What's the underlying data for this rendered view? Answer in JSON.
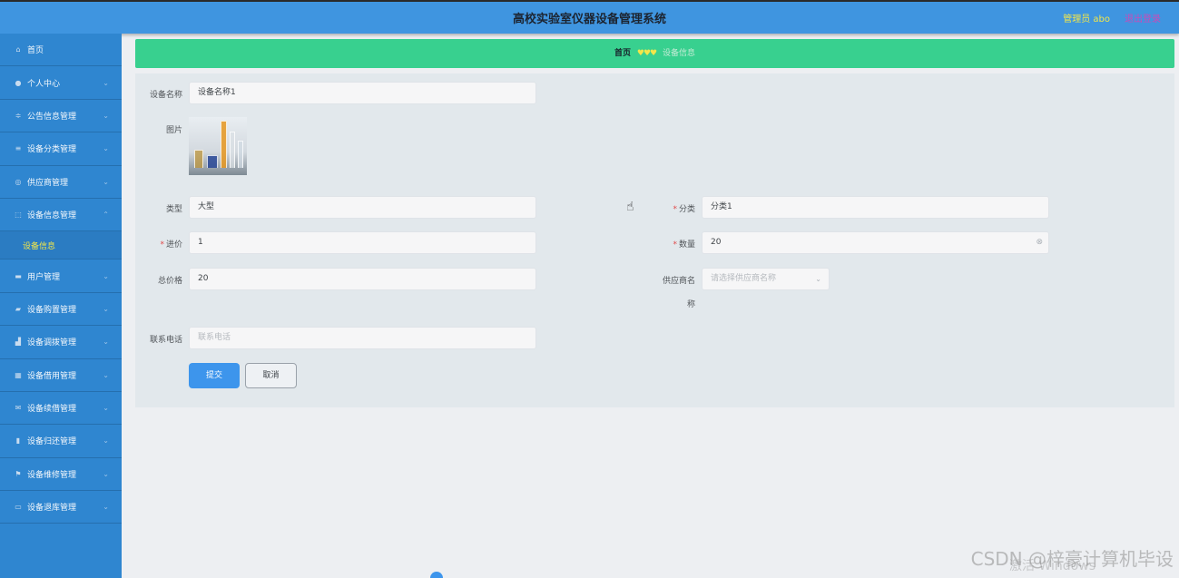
{
  "header": {
    "title": "高校实验室仪器设备管理系统",
    "user": "管理员 abo",
    "logout": "退出登录"
  },
  "sidebar": {
    "items": [
      {
        "label": "首页",
        "icon": "home-icon",
        "expandable": false
      },
      {
        "label": "个人中心",
        "icon": "user-icon",
        "expandable": true
      },
      {
        "label": "公告信息管理",
        "icon": "sliders-icon",
        "expandable": true
      },
      {
        "label": "设备分类管理",
        "icon": "list-icon",
        "expandable": true
      },
      {
        "label": "供应商管理",
        "icon": "compass-icon",
        "expandable": true
      },
      {
        "label": "设备信息管理",
        "icon": "frame-icon",
        "expandable": true
      },
      {
        "label": "用户管理",
        "icon": "folder-icon",
        "expandable": true
      },
      {
        "label": "设备购置管理",
        "icon": "cart-icon",
        "expandable": true
      },
      {
        "label": "设备调拨管理",
        "icon": "transfer-icon",
        "expandable": true
      },
      {
        "label": "设备借用管理",
        "icon": "grid-icon",
        "expandable": true
      },
      {
        "label": "设备续借管理",
        "icon": "mail-icon",
        "expandable": true
      },
      {
        "label": "设备归还管理",
        "icon": "chart-icon",
        "expandable": true
      },
      {
        "label": "设备维修管理",
        "icon": "flag-icon",
        "expandable": true
      },
      {
        "label": "设备退库管理",
        "icon": "message-icon",
        "expandable": true
      }
    ],
    "submenu": {
      "label": "设备信息"
    }
  },
  "breadcrumb": {
    "home": "首页",
    "separator": "♥♥♥",
    "current": "设备信息"
  },
  "form": {
    "name": {
      "label": "设备名称",
      "value": "设备名称1"
    },
    "image": {
      "label": "图片"
    },
    "type": {
      "label": "类型",
      "value": "大型"
    },
    "category": {
      "label": "分类",
      "value": "分类1",
      "required": "*"
    },
    "price": {
      "label": "进价",
      "value": "1",
      "required": "*"
    },
    "quantity": {
      "label": "数量",
      "value": "20",
      "required": "*"
    },
    "total": {
      "label": "总价格",
      "value": "20"
    },
    "supplier": {
      "label": "供应商名",
      "label_wrap": "称",
      "placeholder": "请选择供应商名称"
    },
    "phone": {
      "label": "联系电话",
      "placeholder": "联系电话"
    },
    "submit": "提交",
    "cancel": "取消"
  },
  "watermark": {
    "line1": "CSDN @梓豪计算机毕设",
    "line2": "激活 Windows"
  },
  "colors": {
    "header": "#3f95e0",
    "sidebar": "#2f86d0",
    "breadcrumb": "#38d08f",
    "primary_button": "#3d95ec",
    "accent_yellow": "#f2e64a"
  }
}
